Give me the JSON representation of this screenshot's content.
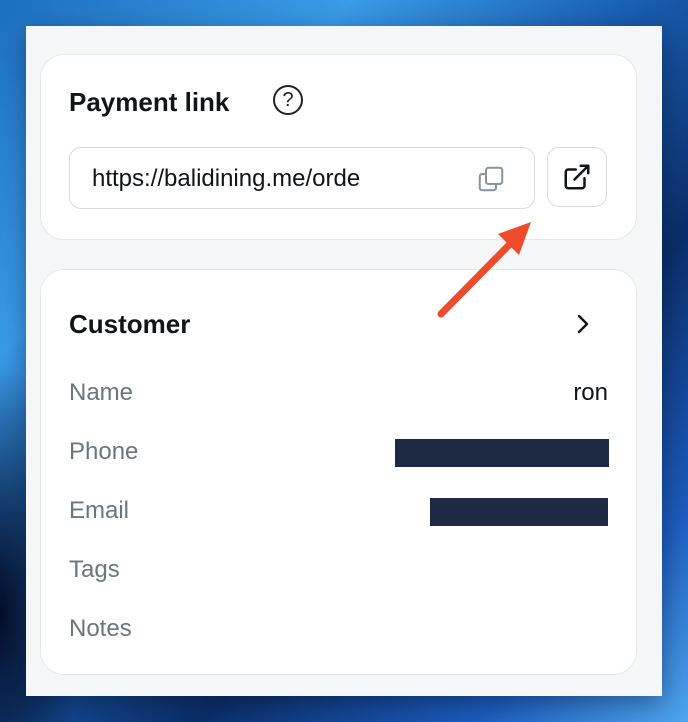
{
  "payment_link": {
    "title": "Payment link",
    "help_symbol": "?",
    "url": "https://balidining.me/orde",
    "copy_icon": "copy-icon",
    "open_icon": "external-link-icon"
  },
  "customer": {
    "title": "Customer",
    "chevron_icon": "chevron-right-icon",
    "fields": {
      "name_label": "Name",
      "name_value": "ron",
      "phone_label": "Phone",
      "email_label": "Email",
      "tags_label": "Tags",
      "notes_label": "Notes"
    }
  },
  "colors": {
    "redaction": "#1e2a44",
    "arrow": "#ee4a2b",
    "muted_label": "#6b7480"
  }
}
